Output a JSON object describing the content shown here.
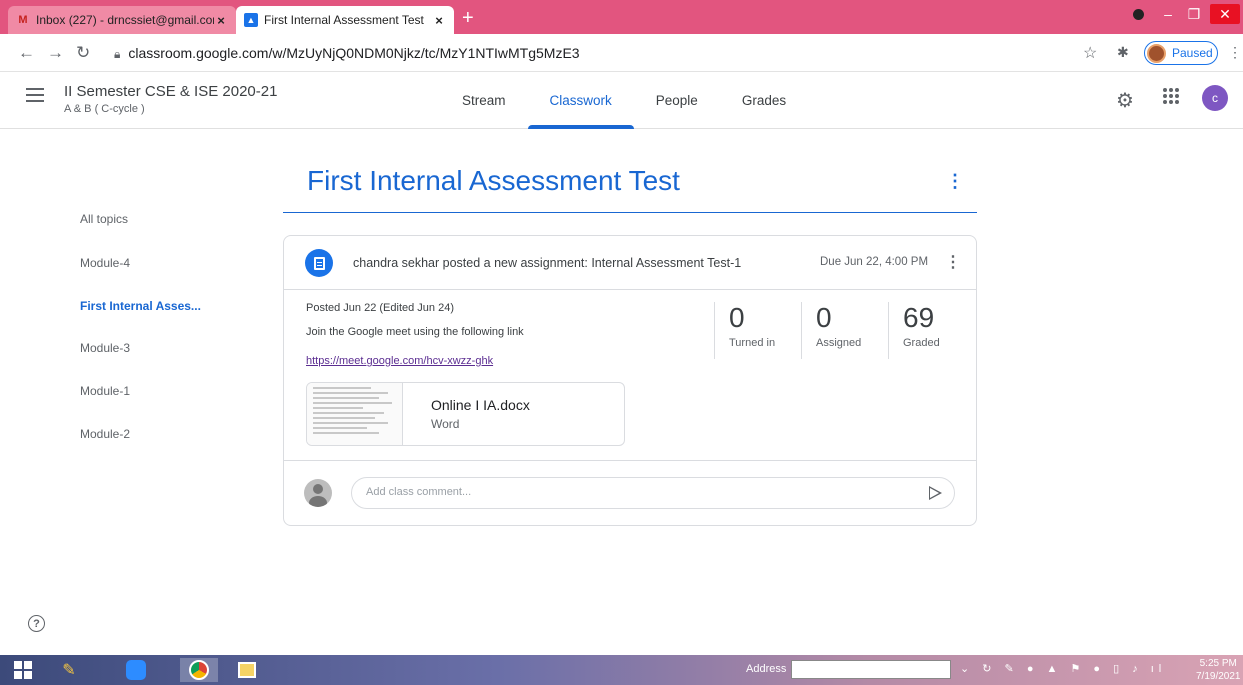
{
  "browser": {
    "tabs": [
      {
        "title": "Inbox (227) - drncssiet@gmail.com",
        "favicon": "gmail-icon"
      },
      {
        "title": "First Internal Assessment Test",
        "favicon": "classroom-icon"
      }
    ],
    "url": "classroom.google.com/w/MzUyNjQ0NDM0Njkz/tc/MzY1NTIwMTg5MzE3",
    "profile_status": "Paused"
  },
  "header": {
    "class_name": "II Semester CSE & ISE 2020-21",
    "section": "A & B ( C-cycle )",
    "tabs": [
      "Stream",
      "Classwork",
      "People",
      "Grades"
    ],
    "active_tab": "Classwork",
    "avatar_letter": "c",
    "accent_color": "#1967d2"
  },
  "topics": [
    "All topics",
    "Module-4",
    "First Internal Asses...",
    "Module-3",
    "Module-1",
    "Module-2"
  ],
  "active_topic": "First Internal Asses...",
  "main": {
    "title": "First Internal Assessment Test",
    "post": {
      "author_line": "chandra sekhar posted a new assignment: Internal Assessment Test-1",
      "due": "Due Jun 22, 4:00 PM",
      "posted": "Posted Jun 22 (Edited Jun 24)",
      "description": "Join the Google meet using the following link",
      "link": "https://meet.google.com/hcv-xwzz-ghk",
      "stats": [
        {
          "value": "0",
          "label": "Turned in"
        },
        {
          "value": "0",
          "label": "Assigned"
        },
        {
          "value": "69",
          "label": "Graded"
        }
      ],
      "attachment": {
        "name": "Online I IA.docx",
        "type": "Word"
      },
      "comment_placeholder": "Add class comment..."
    }
  },
  "taskbar": {
    "address_label": "Address",
    "time": "5:25 PM",
    "date": "7/19/2021"
  }
}
